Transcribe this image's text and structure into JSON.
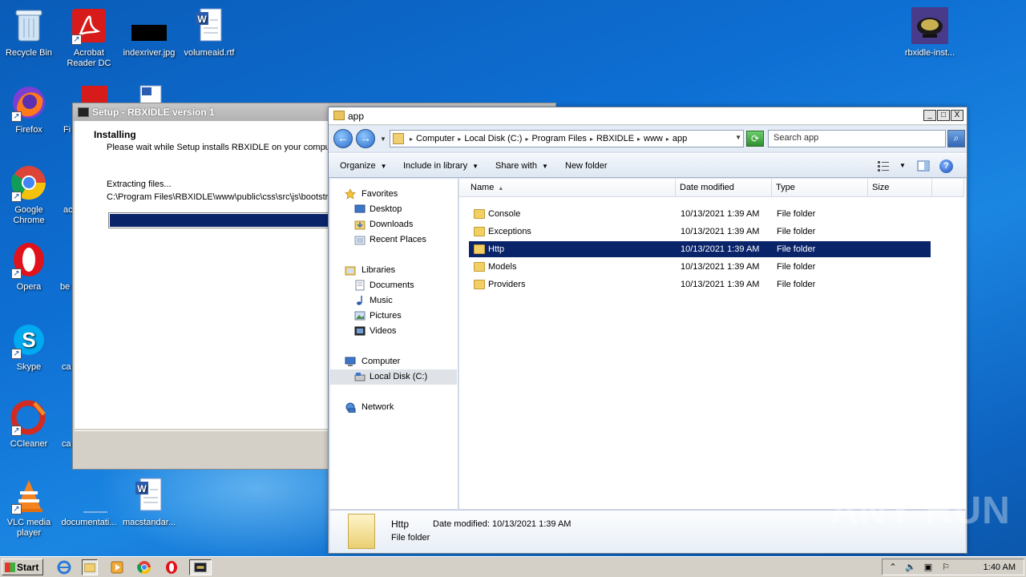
{
  "desktop": {
    "icons": [
      {
        "label": "Recycle Bin"
      },
      {
        "label": "Acrobat Reader DC"
      },
      {
        "label": "indexriver.jpg"
      },
      {
        "label": "volumeaid.rtf"
      },
      {
        "label": "rbxidle-inst..."
      },
      {
        "label": "Firefox"
      },
      {
        "label": "Google Chrome"
      },
      {
        "label": "Opera"
      },
      {
        "label": "Skype"
      },
      {
        "label": "CCleaner"
      },
      {
        "label": "VLC media player"
      },
      {
        "label": "documentati..."
      },
      {
        "label": "macstandar..."
      }
    ],
    "partial_labels": [
      "Fi",
      "ac",
      "be",
      "ca",
      "ca"
    ]
  },
  "setup": {
    "title": "Setup - RBXIDLE version 1",
    "heading": "Installing",
    "subheading": "Please wait while Setup installs RBXIDLE on your computer.",
    "status": "Extracting files...",
    "path": "C:\\Program Files\\RBXIDLE\\www\\public\\css\\src\\js\\bootstrap",
    "progress": 1.0
  },
  "explorer": {
    "title": "app",
    "window_buttons": [
      "_",
      "□",
      "X"
    ],
    "breadcrumbs": [
      "Computer",
      "Local Disk (C:)",
      "Program Files",
      "RBXIDLE",
      "www",
      "app"
    ],
    "search_placeholder": "Search app",
    "toolbar": {
      "organize": "Organize",
      "include": "Include in library",
      "share": "Share with",
      "new_folder": "New folder"
    },
    "nav": {
      "favorites": "Favorites",
      "desktop": "Desktop",
      "downloads": "Downloads",
      "recent": "Recent Places",
      "libraries": "Libraries",
      "documents": "Documents",
      "music": "Music",
      "pictures": "Pictures",
      "videos": "Videos",
      "computer": "Computer",
      "local_disk": "Local Disk (C:)",
      "network": "Network"
    },
    "columns": {
      "name": "Name",
      "date": "Date modified",
      "type": "Type",
      "size": "Size"
    },
    "rows": [
      {
        "name": "Console",
        "date": "10/13/2021 1:39 AM",
        "type": "File folder"
      },
      {
        "name": "Exceptions",
        "date": "10/13/2021 1:39 AM",
        "type": "File folder"
      },
      {
        "name": "Http",
        "date": "10/13/2021 1:39 AM",
        "type": "File folder"
      },
      {
        "name": "Models",
        "date": "10/13/2021 1:39 AM",
        "type": "File folder"
      },
      {
        "name": "Providers",
        "date": "10/13/2021 1:39 AM",
        "type": "File folder"
      }
    ],
    "selected_row": "Http",
    "details": {
      "name": "Http",
      "date_label": "Date modified:",
      "date_value": "10/13/2021 1:39 AM",
      "type": "File folder"
    }
  },
  "watermark": "ANY RUN",
  "taskbar": {
    "start": "Start",
    "clock": "1:40 AM"
  },
  "colors": {
    "selection": "#0a246a",
    "desktop": "#1b86e2"
  }
}
